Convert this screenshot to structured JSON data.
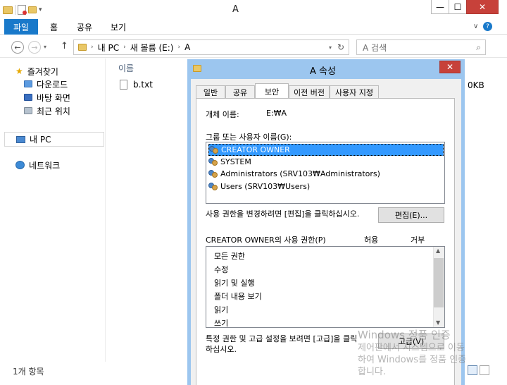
{
  "window": {
    "title": "A",
    "minimize": "—",
    "maximize": "☐",
    "close": "✕"
  },
  "ribbon": {
    "tabs": [
      "파일",
      "홈",
      "공유",
      "보기"
    ]
  },
  "address": {
    "path": [
      "내 PC",
      "새 볼륨 (E:)",
      "A"
    ],
    "search_placeholder": "A 검색"
  },
  "sidebar": {
    "favorites": "즐겨찾기",
    "favorite_items": [
      "다운로드",
      "바탕 화면",
      "최근 위치"
    ],
    "this_pc": "내 PC",
    "network": "네트워크"
  },
  "content": {
    "column_name": "이름",
    "files": [
      {
        "name": "b.txt",
        "size": "0KB"
      }
    ]
  },
  "status": {
    "count": "1개 항목"
  },
  "dialog": {
    "title": "A 속성",
    "tabs": [
      "일반",
      "공유",
      "보안",
      "이전 버전",
      "사용자 지정"
    ],
    "active_tab": "보안",
    "object_name_label": "개체 이름:",
    "object_name_value": "E:₩A",
    "groups_label": "그룹 또는 사용자 이름(G):",
    "groups": [
      "CREATOR OWNER",
      "SYSTEM",
      "Administrators (SRV103₩Administrators)",
      "Users (SRV103₩Users)"
    ],
    "edit_hint": "사용 권한을 변경하려면 [편집]을 클릭하십시오.",
    "edit_button": "편집(E)...",
    "perm_label": "CREATOR OWNER의 사용 권한(P)",
    "allow": "허용",
    "deny": "거부",
    "permissions": [
      "모든 권한",
      "수정",
      "읽기 및 실행",
      "폴더 내용 보기",
      "읽기",
      "쓰기"
    ],
    "advanced_hint_1": "특정 권한 및 고급 설정을 보려면 [고급]을 클릭",
    "advanced_hint_2": "하십시오.",
    "advanced_button": "고급(V)"
  },
  "watermark": {
    "line1": "Windows 정품 인증",
    "line2": "제어판에서 시스템으로 이동",
    "line3": "하여 Windows를 정품 인증",
    "line4": "합니다."
  }
}
